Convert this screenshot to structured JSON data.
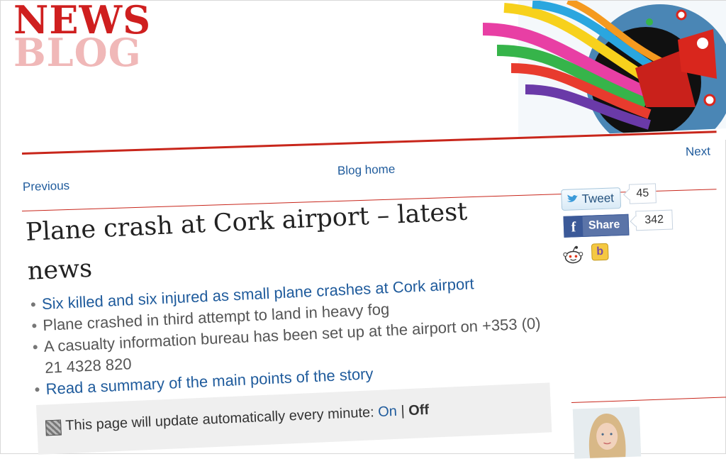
{
  "logo": {
    "line1": "NEWS",
    "line2": "BLOG"
  },
  "nav": {
    "previous": "Previous",
    "blog_home": "Blog home",
    "next": "Next"
  },
  "article": {
    "headline": "Plane crash at Cork airport – latest news",
    "bullets": [
      {
        "text": "Six killed and six injured as small plane crashes at Cork airport",
        "link": true
      },
      {
        "text": "Plane crashed in third attempt to land in heavy fog",
        "link": false
      },
      {
        "text": "A casualty information bureau has been set up at the airport on +353 (0) 21 4328 820",
        "link": false
      },
      {
        "text": "Read a summary of the main points of the story",
        "link": true
      }
    ]
  },
  "social": {
    "tweet_label": "Tweet",
    "tweet_count": "45",
    "share_label": "Share",
    "share_count": "342",
    "icons": [
      "twitter-bird-icon",
      "facebook-icon",
      "reddit-icon",
      "buzz-icon"
    ]
  },
  "update_bar": {
    "text": "This page will update automatically every minute:",
    "on": "On",
    "separator": "|",
    "off": "Off"
  },
  "colors": {
    "brand_red": "#cf1f1f",
    "link_blue": "#1f5b9c",
    "rule_red": "#c8261b"
  }
}
